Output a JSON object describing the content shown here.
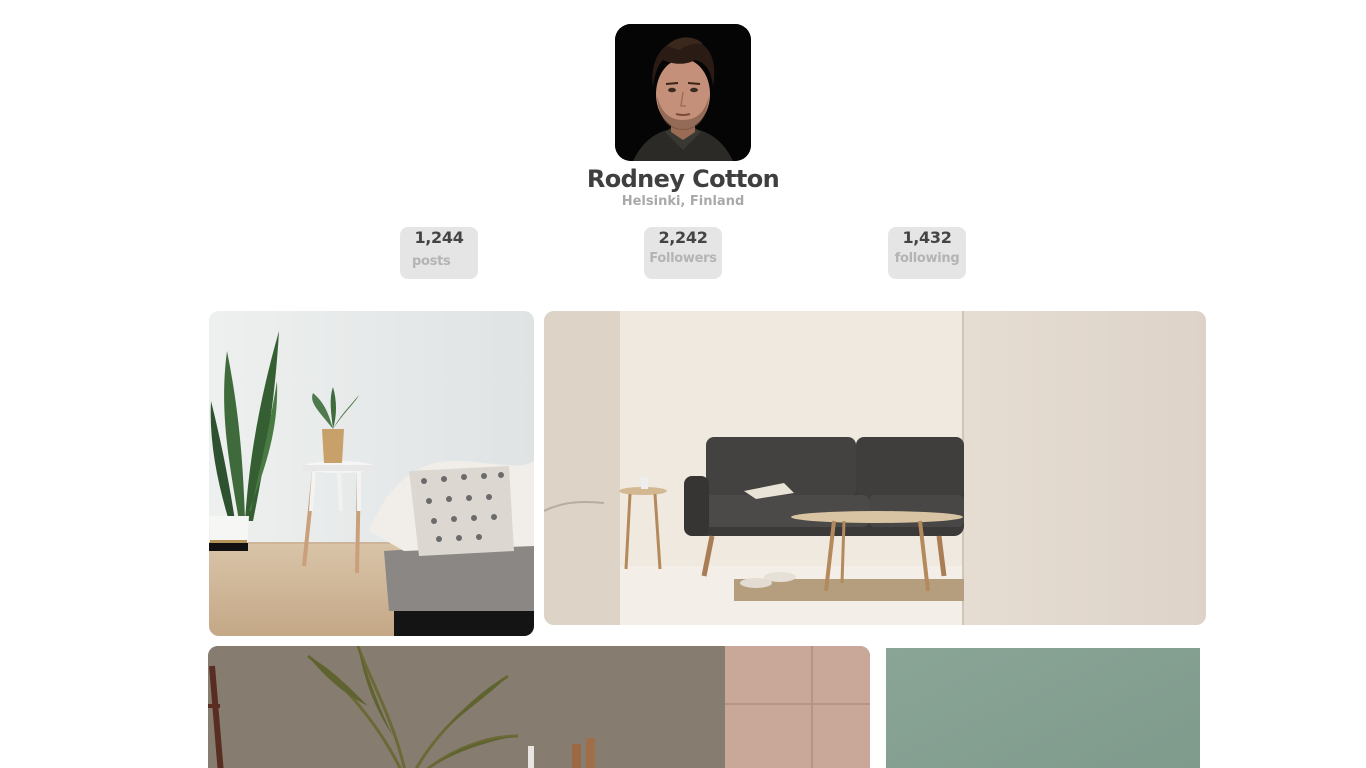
{
  "profile": {
    "name": "Rodney Cotton",
    "location": "Helsinki, Finland"
  },
  "stats": [
    {
      "value": "1,244",
      "label": "posts"
    },
    {
      "value": "2,242",
      "label": "Followers"
    },
    {
      "value": "1,432",
      "label": "following"
    }
  ],
  "gallery": {
    "photos": [
      {
        "subject": "white-room-plant-side-table"
      },
      {
        "subject": "grey-sofa-living-room"
      },
      {
        "subject": "textured-wall-palm"
      },
      {
        "subject": "sage-green-wall"
      }
    ]
  },
  "colors": {
    "name_text": "#3f3f3f",
    "muted_text": "#a9a9a9",
    "stat_bg": "#e5e5e5"
  }
}
